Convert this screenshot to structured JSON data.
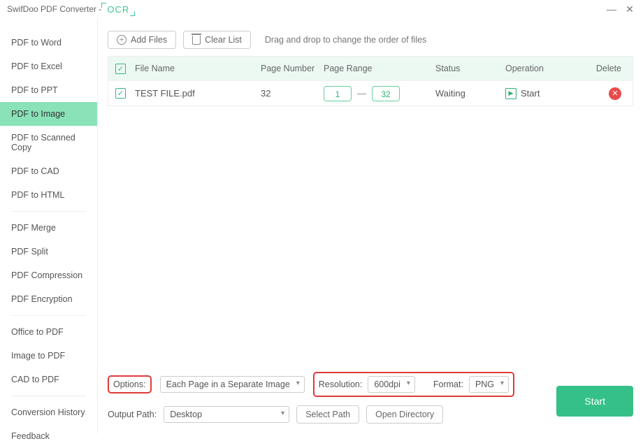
{
  "titlebar": {
    "title": "SwifDoo PDF Converter -",
    "ocr": "OCR"
  },
  "sidebar": {
    "items": [
      "PDF to Word",
      "PDF to Excel",
      "PDF to PPT",
      "PDF to Image",
      "PDF to Scanned Copy",
      "PDF to CAD",
      "PDF to HTML"
    ],
    "group2": [
      "PDF Merge",
      "PDF Split",
      "PDF Compression",
      "PDF Encryption"
    ],
    "group3": [
      "Office to PDF",
      "Image to PDF",
      "CAD to PDF"
    ],
    "group4": [
      "Conversion History",
      "Feedback"
    ],
    "active_index": 3
  },
  "toolbar": {
    "add": "Add Files",
    "clear": "Clear List",
    "hint": "Drag and drop to change the order of files"
  },
  "table": {
    "headers": {
      "name": "File Name",
      "pnum": "Page Number",
      "range": "Page Range",
      "status": "Status",
      "op": "Operation",
      "del": "Delete"
    },
    "rows": [
      {
        "name": "TEST FILE.pdf",
        "pnum": "32",
        "from": "1",
        "to": "32",
        "status": "Waiting",
        "op": "Start"
      }
    ]
  },
  "bottom": {
    "options_lbl": "Options:",
    "options_val": "Each Page in a Separate Image",
    "res_lbl": "Resolution:",
    "res_val": "600dpi",
    "fmt_lbl": "Format:",
    "fmt_val": "PNG",
    "outpath_lbl": "Output Path:",
    "outpath_val": "Desktop",
    "selectpath": "Select Path",
    "opendir": "Open Directory",
    "start": "Start"
  }
}
